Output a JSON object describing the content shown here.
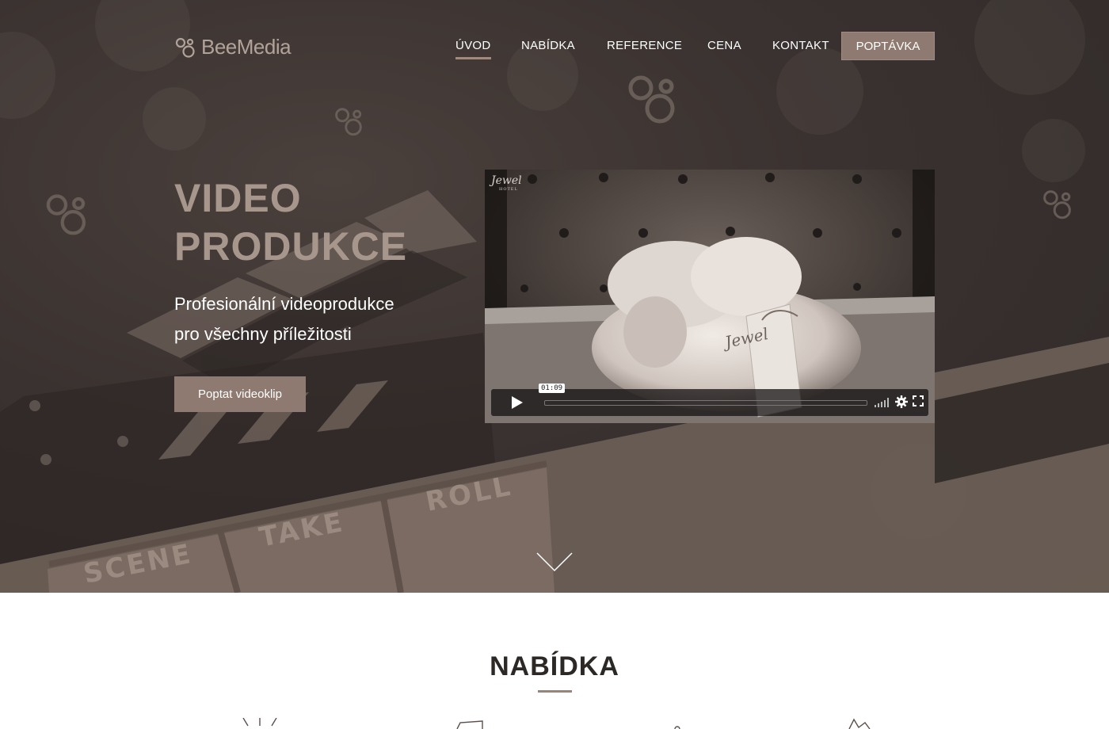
{
  "brand": {
    "name": "BeeMedia",
    "accent": "#8e7a70",
    "rule": "#9a8478"
  },
  "nav": {
    "items": [
      {
        "label": "ÚVOD",
        "active": true
      },
      {
        "label": "NABÍDKA",
        "active": false
      },
      {
        "label": "REFERENCE",
        "active": false
      },
      {
        "label": "CENA",
        "active": false
      },
      {
        "label": "KONTAKT",
        "active": false
      }
    ],
    "cta": "POPTÁVKA"
  },
  "hero": {
    "title_line1": "VIDEO",
    "title_line2": "PRODUKCE",
    "subtitle_line1": "Profesionální videoprodukce",
    "subtitle_line2": "pro všechny příležitosti",
    "button": "Poptat videoklip",
    "clapper_labels": [
      "SCENE",
      "TAKE",
      "ROLL"
    ]
  },
  "video": {
    "watermark": "Jewel",
    "watermark_sub": "HOTEL",
    "tag_text": "Jewel",
    "time": "01:09",
    "icons": [
      "play-icon",
      "volume-icon",
      "settings-icon",
      "fullscreen-icon"
    ]
  },
  "scroll_icon": "chevron-down-icon",
  "offer": {
    "title": "NABÍDKA",
    "icons": [
      "sparkle-icon",
      "card-icon",
      "dot-icon",
      "star-icon"
    ]
  }
}
